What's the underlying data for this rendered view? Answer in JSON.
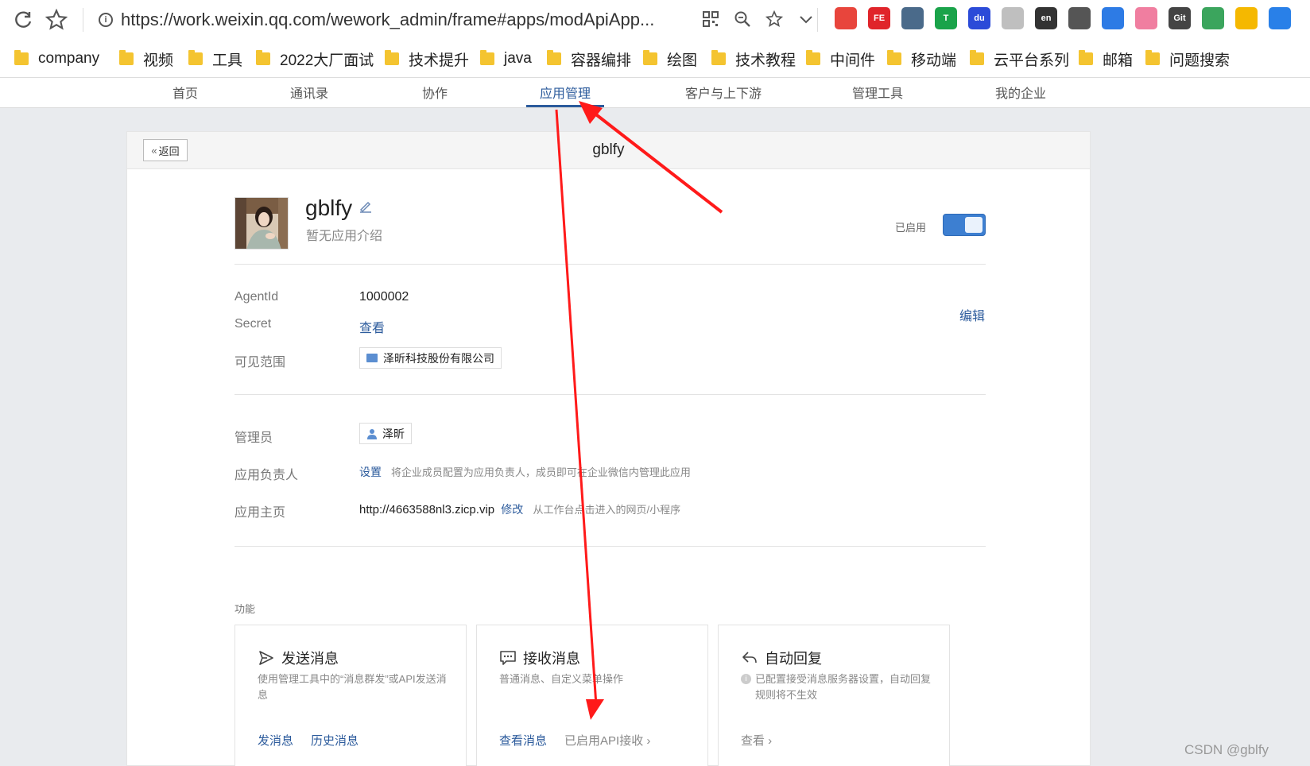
{
  "browser": {
    "url": "https://work.weixin.qq.com/wework_admin/frame#apps/modApiApp...",
    "bookmarks": [
      "company",
      "视频",
      "工具",
      "2022大厂面试",
      "技术提升",
      "java",
      "容器编排",
      "绘图",
      "技术教程",
      "中间件",
      "移动端",
      "云平台系列",
      "邮箱",
      "问题搜索"
    ],
    "extensions": [
      {
        "icon": "red-bag-ext-icon",
        "color": "#e8453c",
        "text": ""
      },
      {
        "icon": "fe-ext-icon",
        "color": "#e0242a",
        "text": "FE"
      },
      {
        "icon": "puzzle-ext-icon",
        "color": "#4a6a8a",
        "text": ""
      },
      {
        "icon": "shield-ext-icon",
        "color": "#1aa34a",
        "text": "T"
      },
      {
        "icon": "du-ext-icon",
        "color": "#2b4bd8",
        "text": "du"
      },
      {
        "icon": "download-ext-icon",
        "color": "#bfbfbf",
        "text": ""
      },
      {
        "icon": "translate-ext-icon",
        "color": "#333333",
        "text": "en"
      },
      {
        "icon": "palette-ext-icon",
        "color": "#555555",
        "text": ""
      },
      {
        "icon": "grid-ext-icon",
        "color": "#2d7be5",
        "text": ""
      },
      {
        "icon": "bilibili-ext-icon",
        "color": "#f07ea0",
        "text": ""
      },
      {
        "icon": "gitzip-ext-icon",
        "color": "#444444",
        "text": "Git"
      },
      {
        "icon": "windows-ext-icon",
        "color": "#3ba55d",
        "text": ""
      },
      {
        "icon": "moon-ext-icon",
        "color": "#f5b800",
        "text": ""
      },
      {
        "icon": "scissors-ext-icon",
        "color": "#2980e8",
        "text": ""
      }
    ]
  },
  "nav": {
    "items": [
      "首页",
      "通讯录",
      "协作",
      "应用管理",
      "客户与上下游",
      "管理工具",
      "我的企业"
    ],
    "active": "应用管理"
  },
  "card": {
    "back_label": "返回",
    "title": "gblfy"
  },
  "app": {
    "name": "gblfy",
    "description": "暂无应用介绍",
    "status_label": "已启用",
    "enabled": true
  },
  "info": {
    "edit_label": "编辑",
    "agentid_label": "AgentId",
    "agentid_value": "1000002",
    "secret_label": "Secret",
    "secret_value": "查看",
    "scope_label": "可见范围",
    "scope_value": "泽昕科技股份有限公司"
  },
  "admin": {
    "admin_label": "管理员",
    "admin_value": "泽昕",
    "owner_label": "应用负责人",
    "owner_link": "设置",
    "owner_hint": "将企业成员配置为应用负责人，成员即可在企业微信内管理此应用",
    "home_label": "应用主页",
    "home_url": "http://4663588nl3.zicp.vip",
    "home_modify": "修改",
    "home_hint": "从工作台点击进入的网页/小程序"
  },
  "functions": {
    "title": "功能",
    "cards": [
      {
        "title": "发送消息",
        "desc": "使用管理工具中的“消息群发”或API发送消息",
        "link1": "发消息",
        "link2": "历史消息"
      },
      {
        "title": "接收消息",
        "desc": "普通消息、自定义菜单操作",
        "link1": "查看消息",
        "link2": "已启用API接收 ›"
      },
      {
        "title": "自动回复",
        "desc": "已配置接受消息服务器设置，自动回复规则将不生效",
        "link1": "查看 ›"
      }
    ]
  },
  "watermark": "CSDN @gblfy",
  "annotation_color": "#ff1a1a"
}
